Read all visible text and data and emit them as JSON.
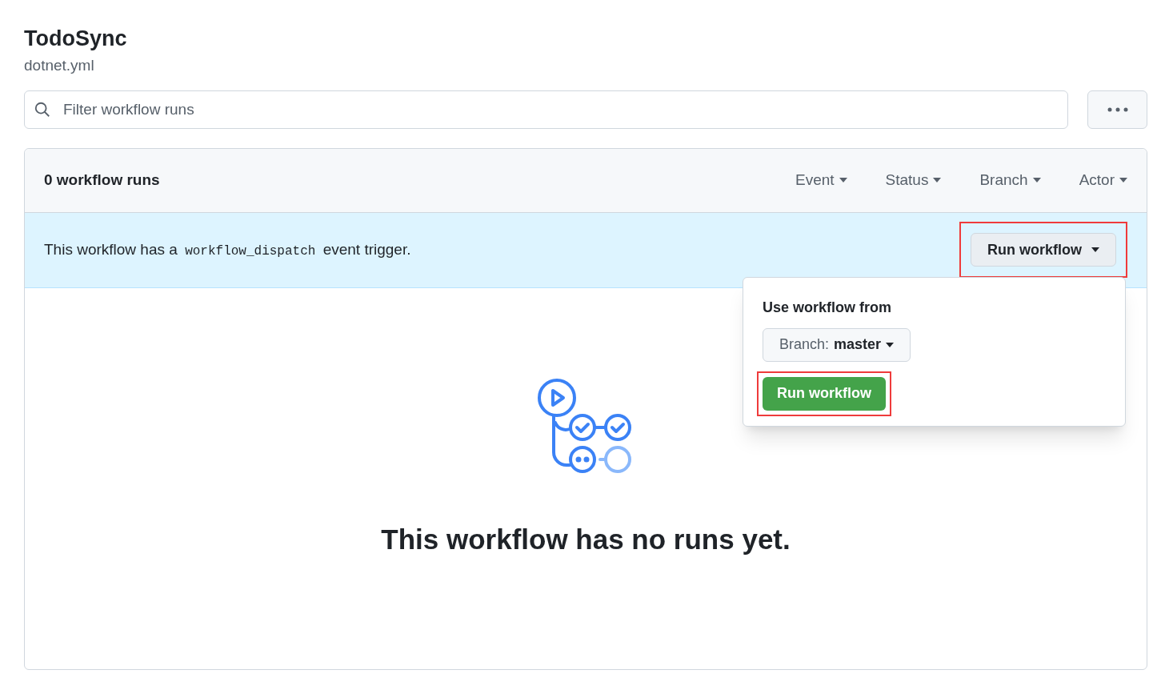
{
  "header": {
    "title": "TodoSync",
    "subtitle": "dotnet.yml"
  },
  "search": {
    "placeholder": "Filter workflow runs"
  },
  "runs_panel": {
    "count_label": "0 workflow runs",
    "filters": [
      {
        "label": "Event"
      },
      {
        "label": "Status"
      },
      {
        "label": "Branch"
      },
      {
        "label": "Actor"
      }
    ]
  },
  "banner": {
    "text_before": "This workflow has a",
    "code": "workflow_dispatch",
    "text_after": "event trigger.",
    "button": {
      "label": "Run workflow",
      "highlighted": true,
      "expanded": true
    }
  },
  "run_menu": {
    "heading": "Use workflow from",
    "branch_prefix": "Branch:",
    "branch": "master",
    "submit": {
      "label": "Run workflow",
      "highlighted": true
    }
  },
  "empty_state": {
    "message": "This workflow has no runs yet."
  }
}
